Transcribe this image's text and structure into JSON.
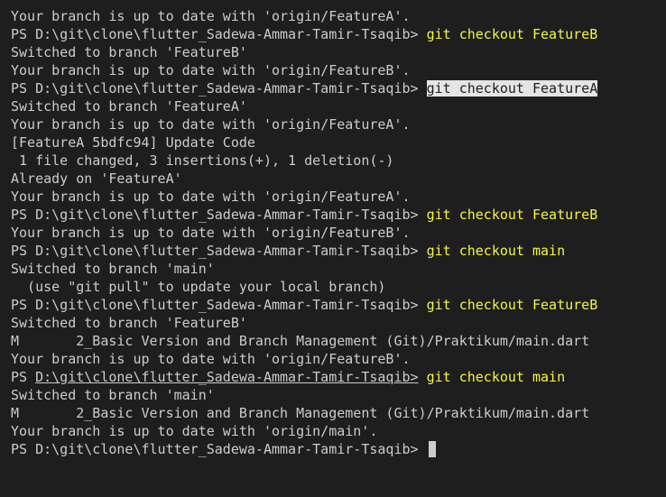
{
  "terminal": {
    "prompt": "PS D:\\git\\clone\\flutter_Sadewa-Ammar-Tamir-Tsaqib>",
    "colors": {
      "background": "#1e1e1e",
      "text": "#cccccc",
      "command": "#f5f543",
      "selection": "#e5e5e5"
    },
    "lines": [
      {
        "kind": "out",
        "text": "Your branch is up to date with 'origin/FeatureA'."
      },
      {
        "kind": "cmd",
        "command": "git checkout FeatureB"
      },
      {
        "kind": "out",
        "text": "Switched to branch 'FeatureB'"
      },
      {
        "kind": "out",
        "text": "Your branch is up to date with 'origin/FeatureB'."
      },
      {
        "kind": "cmd",
        "command": "git checkout FeatureA",
        "selected": true
      },
      {
        "kind": "out",
        "text": "Switched to branch 'FeatureA'"
      },
      {
        "kind": "out",
        "text": "Your branch is up to date with 'origin/FeatureA'."
      },
      {
        "kind": "out",
        "text": "[FeatureA 5bdfc94] Update Code"
      },
      {
        "kind": "out",
        "text": " 1 file changed, 3 insertions(+), 1 deletion(-)"
      },
      {
        "kind": "out",
        "text": "Already on 'FeatureA'"
      },
      {
        "kind": "out",
        "text": "Your branch is up to date with 'origin/FeatureA'."
      },
      {
        "kind": "cmd",
        "command": "git checkout FeatureB"
      },
      {
        "kind": "out",
        "text": "Your branch is up to date with 'origin/FeatureB'."
      },
      {
        "kind": "cmd",
        "command": "git checkout main"
      },
      {
        "kind": "out",
        "text": "Switched to branch 'main'"
      },
      {
        "kind": "out",
        "text": "  (use \"git pull\" to update your local branch)"
      },
      {
        "kind": "cmd",
        "command": "git checkout FeatureB"
      },
      {
        "kind": "out",
        "text": "Switched to branch 'FeatureB'"
      },
      {
        "kind": "out",
        "text": "M       2_Basic Version and Branch Management (Git)/Praktikum/main.dart"
      },
      {
        "kind": "out",
        "text": "Your branch is up to date with 'origin/FeatureB'."
      },
      {
        "kind": "cmd",
        "command": "git checkout main",
        "link_prompt": true
      },
      {
        "kind": "out",
        "text": "Switched to branch 'main'"
      },
      {
        "kind": "out",
        "text": "M       2_Basic Version and Branch Management (Git)/Praktikum/main.dart"
      },
      {
        "kind": "out",
        "text": "Your branch is up to date with 'origin/main'."
      },
      {
        "kind": "cmd",
        "command": "",
        "cursor": true
      }
    ]
  }
}
